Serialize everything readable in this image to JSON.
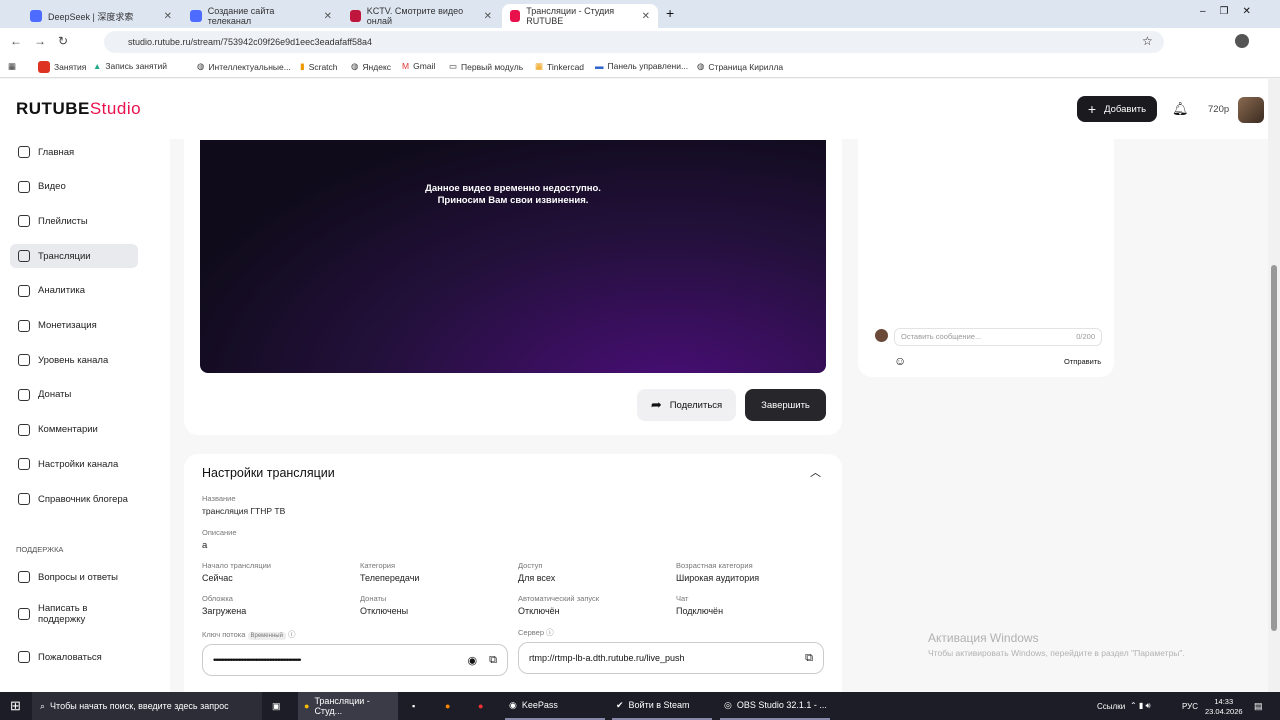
{
  "browser": {
    "tabs": [
      {
        "title": "DeepSeek | 深度求索"
      },
      {
        "title": "Создание сайта телеканал"
      },
      {
        "title": "KCTV. Смотрите видео онлай"
      },
      {
        "title": "Трансляции - Студия RUTUBE"
      }
    ],
    "url": "studio.rutube.ru/stream/753942c09f26e9d1eec3eadafaff58a4",
    "bookmarks": [
      "Занятия",
      "Запись занятий",
      "Интеллектуальные...",
      "Scratch",
      "Яндекс",
      "Gmail",
      "Первый модуль",
      "Tinkercad",
      "Панель управлени...",
      "Страница Кирилла"
    ]
  },
  "header": {
    "logo": "RUTUBE",
    "logo_suffix": "Studio",
    "add_label": "Добавить",
    "quality": "720p"
  },
  "sidebar": {
    "items": [
      "Главная",
      "Видео",
      "Плейлисты",
      "Трансляции",
      "Аналитика",
      "Монетизация",
      "Уровень канала",
      "Донаты",
      "Комментарии",
      "Настройки канала",
      "Справочник блогера"
    ],
    "support_title": "ПОДДЕРЖКА",
    "support_items": [
      "Вопросы и ответы",
      "Написать в поддержку",
      "Пожаловаться"
    ]
  },
  "player": {
    "line1": "Данное видео временно недоступно.",
    "line2": "Приносим Вам свои извинения."
  },
  "actions": {
    "share": "Поделиться",
    "finish": "Завершить"
  },
  "chat": {
    "placeholder": "Оставить сообщение...",
    "counter": "0/200",
    "send": "Отправить"
  },
  "settings": {
    "title": "Настройки трансляции",
    "name_label": "Название",
    "name": "трансляция ГТНР ТВ",
    "desc_label": "Описание",
    "desc": "а",
    "fields": [
      {
        "label": "Начало трансляции",
        "value": "Сейчас"
      },
      {
        "label": "Категория",
        "value": "Телепередачи"
      },
      {
        "label": "Доступ",
        "value": "Для всех"
      },
      {
        "label": "Возрастная категория",
        "value": "Широкая аудитория"
      },
      {
        "label": "Обложка",
        "value": "Загружена"
      },
      {
        "label": "Донаты",
        "value": "Отключены"
      },
      {
        "label": "Автоматический запуск",
        "value": "Отключён"
      },
      {
        "label": "Чат",
        "value": "Подключён"
      }
    ],
    "key_label": "Ключ потока",
    "key_badge": "Временный",
    "key_value": "••••••••••••••••••••••••••••••••••••••••••••••••••••••••",
    "server_label": "Сервер",
    "server_value": "rtmp://rtmp-lb-a.dth.rutube.ru/live_push"
  },
  "watermark": {
    "title": "Активация Windows",
    "text": "Чтобы активировать Windows, перейдите в раздел \"Параметры\"."
  },
  "taskbar": {
    "search": "Чтобы начать поиск, введите здесь запрос",
    "apps": [
      "Трансляции - Студ...",
      "KeePass",
      "Войти в Steam",
      "OBS Studio 32.1.1 - ..."
    ],
    "links": "Ссылки",
    "lang": "РУС",
    "time": "14:33",
    "date": "23.04.2026"
  }
}
